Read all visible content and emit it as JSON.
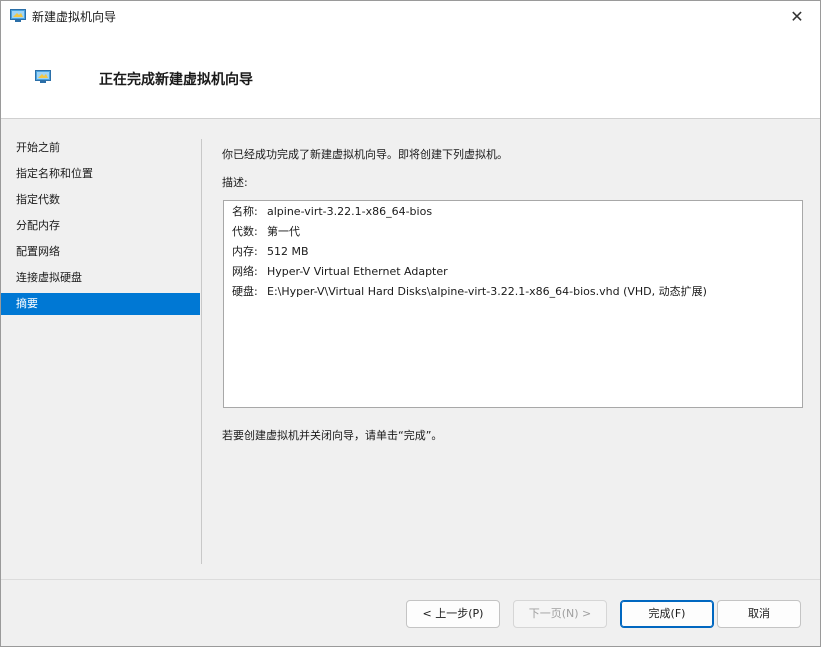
{
  "window": {
    "title": "新建虚拟机向导",
    "close_glyph": "✕"
  },
  "header": {
    "title": "正在完成新建虚拟机向导"
  },
  "nav": {
    "items": [
      {
        "label": "开始之前"
      },
      {
        "label": "指定名称和位置"
      },
      {
        "label": "指定代数"
      },
      {
        "label": "分配内存"
      },
      {
        "label": "配置网络"
      },
      {
        "label": "连接虚拟硬盘"
      },
      {
        "label": "摘要",
        "active": true
      }
    ]
  },
  "main": {
    "intro": "你已经成功完成了新建虚拟机向导。即将创建下列虚拟机。",
    "description_label": "描述:",
    "summary": [
      {
        "key": "名称:",
        "value": "alpine-virt-3.22.1-x86_64-bios"
      },
      {
        "key": "代数:",
        "value": "第一代"
      },
      {
        "key": "内存:",
        "value": "512 MB"
      },
      {
        "key": "网络:",
        "value": "Hyper-V Virtual Ethernet Adapter"
      },
      {
        "key": "硬盘:",
        "value": "E:\\Hyper-V\\Virtual Hard Disks\\alpine-virt-3.22.1-x86_64-bios.vhd (VHD, 动态扩展)"
      }
    ],
    "footer_note": "若要创建虚拟机并关闭向导，请单击“完成”。"
  },
  "buttons": {
    "previous": "< 上一步(P)",
    "next": "下一页(N) >",
    "finish": "完成(F)",
    "cancel": "取消"
  },
  "colors": {
    "accent": "#0078d4"
  },
  "icons": {
    "title": "vm-monitor-icon",
    "header": "vm-monitor-icon",
    "close": "close-icon"
  }
}
